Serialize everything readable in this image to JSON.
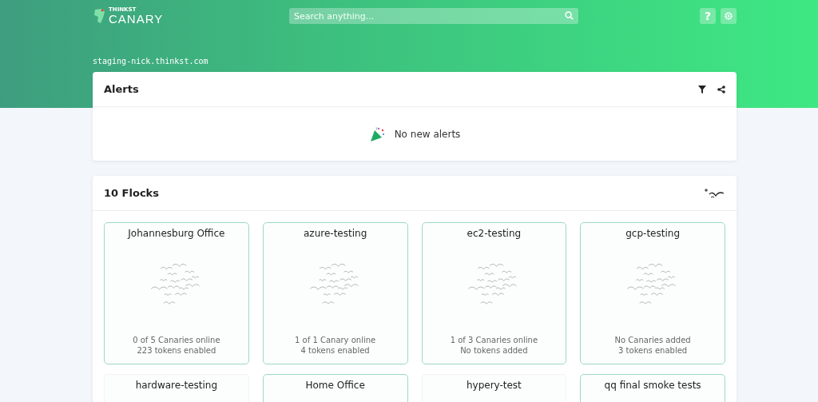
{
  "header": {
    "logo_small": "THINKST",
    "logo_big": "CANARY",
    "search": {
      "placeholder": "Search anything..."
    },
    "help_label": "?",
    "hostname": "staging-nick.thinkst.com"
  },
  "alerts": {
    "title": "Alerts",
    "empty_message": "No new alerts"
  },
  "flocks": {
    "title": "10 Flocks",
    "items": [
      {
        "name": "Johannesburg Office",
        "canaries": "0 of 5 Canaries online",
        "tokens": "223 tokens enabled",
        "outlined": true
      },
      {
        "name": "azure-testing",
        "canaries": "1 of 1 Canary online",
        "tokens": "4 tokens enabled",
        "outlined": true
      },
      {
        "name": "ec2-testing",
        "canaries": "1 of 3 Canaries online",
        "tokens": "No tokens added",
        "outlined": true
      },
      {
        "name": "gcp-testing",
        "canaries": "No Canaries added",
        "tokens": "3 tokens enabled",
        "outlined": true
      },
      {
        "name": "hardware-testing",
        "outlined": false
      },
      {
        "name": "Home Office",
        "outlined": true
      },
      {
        "name": "hypery-test",
        "outlined": false
      },
      {
        "name": "qq final smoke tests",
        "outlined": true
      }
    ]
  }
}
